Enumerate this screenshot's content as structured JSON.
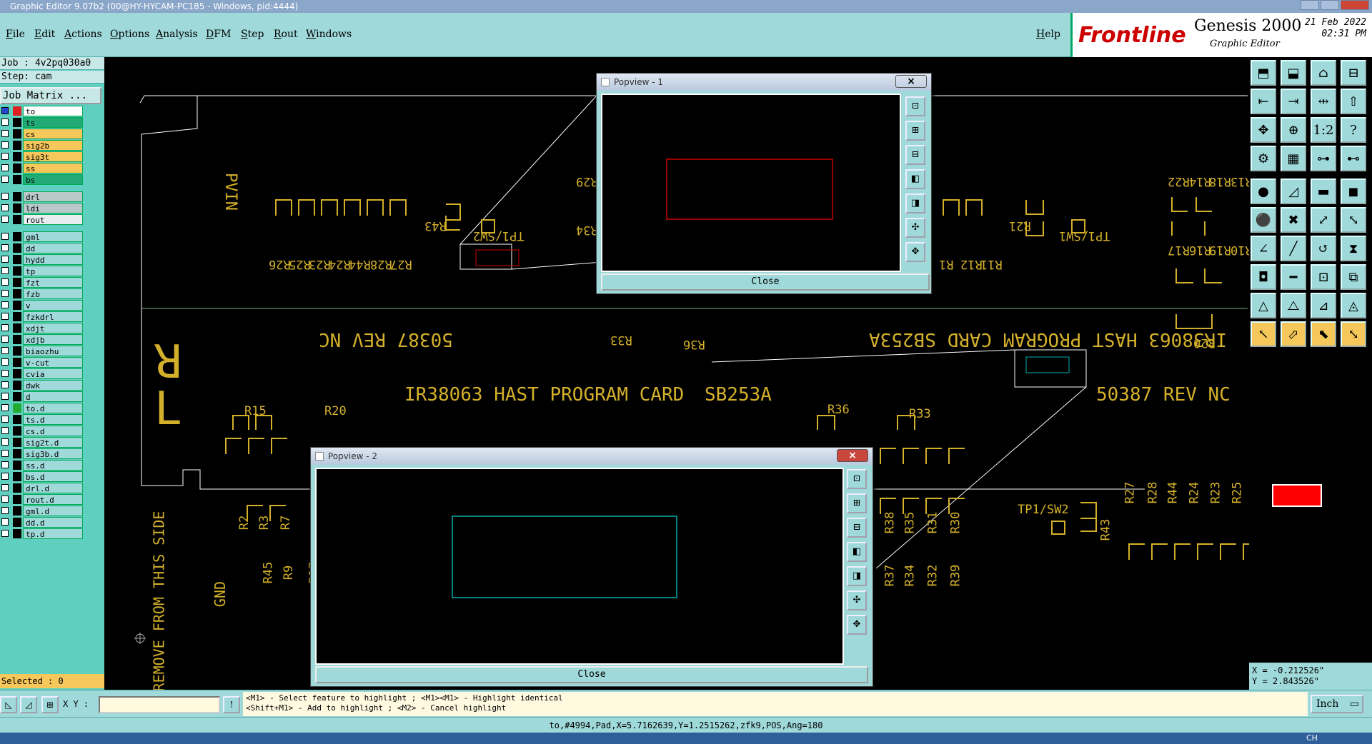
{
  "window": {
    "title": "Graphic Editor 9.07b2 (00@HY-HYCAM-PC185 - Windows, pid:4444)"
  },
  "menu": {
    "items": [
      "File",
      "Edit",
      "Actions",
      "Options",
      "Analysis",
      "DFM",
      "Step",
      "Rout",
      "Windows"
    ],
    "help": "Help"
  },
  "brand": {
    "logo": "Frontline",
    "product": "Genesis 2000",
    "subtitle": "Graphic Editor",
    "date": "21 Feb 2022",
    "time": "02:31 PM"
  },
  "job": {
    "job_label": "Job : 4v2pq030a0",
    "step_label": "Step: cam",
    "matrix_button": "Job Matrix ..."
  },
  "layers": [
    {
      "name": "to",
      "color": "#ffffff",
      "swatch": "#e02020",
      "checked": true
    },
    {
      "name": "ts",
      "color": "#22aa77",
      "swatch": "#000000"
    },
    {
      "name": "cs",
      "color": "#f6c75a",
      "swatch": "#000000"
    },
    {
      "name": "sig2b",
      "color": "#f6c75a",
      "swatch": "#000000"
    },
    {
      "name": "sig3t",
      "color": "#f6c75a",
      "swatch": "#000000"
    },
    {
      "name": "ss",
      "color": "#f6c75a",
      "swatch": "#000000"
    },
    {
      "name": "bs",
      "color": "#22aa77",
      "swatch": "#000000"
    },
    {
      "name": "drl",
      "color": "#b9c9c9",
      "swatch": "#000000"
    },
    {
      "name": "ldi",
      "color": "#b9c9c9",
      "swatch": "#000000"
    },
    {
      "name": "rout",
      "color": "#e8eeee",
      "swatch": "#000000"
    },
    {
      "name": "gml",
      "color": "#9fd9d9",
      "swatch": "#000000"
    },
    {
      "name": "dd",
      "color": "#9fd9d9",
      "swatch": "#000000"
    },
    {
      "name": "hydd",
      "color": "#9fd9d9",
      "swatch": "#000000"
    },
    {
      "name": "tp",
      "color": "#9fd9d9",
      "swatch": "#000000"
    },
    {
      "name": "fzt",
      "color": "#9fd9d9",
      "swatch": "#000000"
    },
    {
      "name": "fzb",
      "color": "#9fd9d9",
      "swatch": "#000000"
    },
    {
      "name": "v",
      "color": "#9fd9d9",
      "swatch": "#000000"
    },
    {
      "name": "fzkdrl",
      "color": "#9fd9d9",
      "swatch": "#000000"
    },
    {
      "name": "xdjt",
      "color": "#9fd9d9",
      "swatch": "#000000"
    },
    {
      "name": "xdjb",
      "color": "#9fd9d9",
      "swatch": "#000000"
    },
    {
      "name": "biaozhu",
      "color": "#9fd9d9",
      "swatch": "#000000"
    },
    {
      "name": "v-cut",
      "color": "#9fd9d9",
      "swatch": "#000000"
    },
    {
      "name": "cvia",
      "color": "#9fd9d9",
      "swatch": "#000000"
    },
    {
      "name": "dwk",
      "color": "#9fd9d9",
      "swatch": "#000000"
    },
    {
      "name": "d",
      "color": "#9fd9d9",
      "swatch": "#000000"
    },
    {
      "name": "to.d",
      "color": "#9fd9d9",
      "swatch": "#22aa33"
    },
    {
      "name": "ts.d",
      "color": "#9fd9d9",
      "swatch": "#000000"
    },
    {
      "name": "cs.d",
      "color": "#9fd9d9",
      "swatch": "#000000"
    },
    {
      "name": "sig2t.d",
      "color": "#9fd9d9",
      "swatch": "#000000"
    },
    {
      "name": "sig3b.d",
      "color": "#9fd9d9",
      "swatch": "#000000"
    },
    {
      "name": "ss.d",
      "color": "#9fd9d9",
      "swatch": "#000000"
    },
    {
      "name": "bs.d",
      "color": "#9fd9d9",
      "swatch": "#000000"
    },
    {
      "name": "drl.d",
      "color": "#9fd9d9",
      "swatch": "#000000"
    },
    {
      "name": "rout.d",
      "color": "#9fd9d9",
      "swatch": "#000000"
    },
    {
      "name": "gml.d",
      "color": "#9fd9d9",
      "swatch": "#000000"
    },
    {
      "name": "dd.d",
      "color": "#9fd9d9",
      "swatch": "#000000"
    },
    {
      "name": "tp.d",
      "color": "#9fd9d9",
      "swatch": "#000000"
    }
  ],
  "selected": "Selected : 0",
  "board": {
    "top_labels": [
      "R26",
      "R25",
      "R23",
      "R24",
      "R44",
      "R28",
      "R27",
      "R43",
      "TP1/SW2",
      "R29",
      "R34",
      "R33",
      "R36",
      "R1",
      "R12",
      "R11",
      "R21",
      "TP1/SW1",
      "R22",
      "R14",
      "R18",
      "R13",
      "R17",
      "R16",
      "R19",
      "R10",
      "R20"
    ],
    "mirror_text": "IR38063 HAST PROGRAM CARD    SB253A",
    "mirror_rev": "50387 REV NC",
    "pvin": "PVIN",
    "r_mark": "R",
    "l_mark": "L",
    "card_title": "IR38063 HAST PROGRAM CARD",
    "card_code": "SB253A",
    "card_rev": "50387 REV NC",
    "bottom_labels": [
      "R15",
      "R20",
      "R2",
      "R3",
      "R7",
      "R45",
      "R9",
      "R17",
      "R36",
      "R33",
      "R38",
      "R35",
      "R31",
      "R30",
      "R37",
      "R34",
      "R32",
      "R39",
      "TP1/SW2",
      "R43",
      "R27",
      "R28",
      "R44",
      "R24",
      "R23",
      "R25"
    ],
    "remove_text": "REMOVE FROM THIS SIDE",
    "gnd": "GND"
  },
  "popview1": {
    "title": "Popview - 1",
    "close": "Close"
  },
  "popview2": {
    "title": "Popview - 2",
    "close": "Close"
  },
  "coords": {
    "x": "X = -0.212526\"",
    "y": "Y = 2.843526\""
  },
  "xy_label": "X Y :",
  "xy_value": "",
  "hint1": "<M1> - Select feature to highlight ; <M1><M1> - Highlight identical",
  "hint2": "<Shift+M1> - Add to highlight ; <M2> - Cancel highlight",
  "units": "Inch",
  "status": "to,#4994,Pad,X=5.7162639,Y=1.2515262,zfk9,POS,Ang=180",
  "taskbar_lang": "CH"
}
